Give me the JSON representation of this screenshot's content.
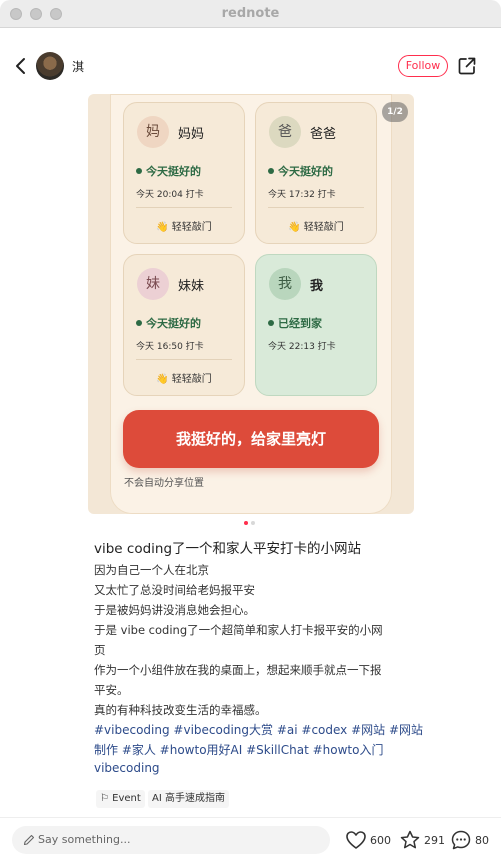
{
  "window": {
    "title": "rednote"
  },
  "header": {
    "username": "淇",
    "follow_label": "Follow"
  },
  "image": {
    "page_indicator": "1/2",
    "members": [
      {
        "avatar_char": "妈",
        "name": "妈妈",
        "status": "今天挺好的",
        "time": "今天 20:04 打卡",
        "knock": "👋 轻轻敲门"
      },
      {
        "avatar_char": "爸",
        "name": "爸爸",
        "status": "今天挺好的",
        "time": "今天 17:32 打卡",
        "knock": "👋 轻轻敲门"
      },
      {
        "avatar_char": "妹",
        "name": "妹妹",
        "status": "今天挺好的",
        "time": "今天 16:50 打卡",
        "knock": "👋 轻轻敲门"
      },
      {
        "avatar_char": "我",
        "name": "我",
        "status": "已经到家",
        "time": "今天 22:13 打卡"
      }
    ],
    "main_button": "我挺好的，给家里亮灯",
    "note": "不会自动分享位置"
  },
  "post": {
    "title": "vibe coding了一个和家人平安打卡的小网站",
    "lines": [
      "因为自己一个人在北京",
      "又太忙了总没时间给老妈报平安",
      "于是被妈妈讲没消息她会担心。",
      "于是 vibe coding了一个超简单和家人打卡报平安的小网",
      "页",
      "作为一个小组件放在我的桌面上，想起来顺手就点一下报",
      "平安。",
      "真的有种科技改变生活的幸福感。"
    ],
    "tags_lines": [
      "#vibecoding #vibecoding大赏 #ai #codex #网站 #网站",
      "制作 #家人 #howto用好AI #SkillChat #howto入门",
      "vibecoding"
    ],
    "chips": [
      "Event",
      "AI 高手速成指南"
    ]
  },
  "footer": {
    "comment_placeholder": "Say something...",
    "likes": "600",
    "collects": "291",
    "comments": "80"
  },
  "colors": {
    "accent": "#ff2e4d",
    "tag": "#2d4b8a",
    "button": "#dd4b3a",
    "status": "#2d6a44"
  }
}
